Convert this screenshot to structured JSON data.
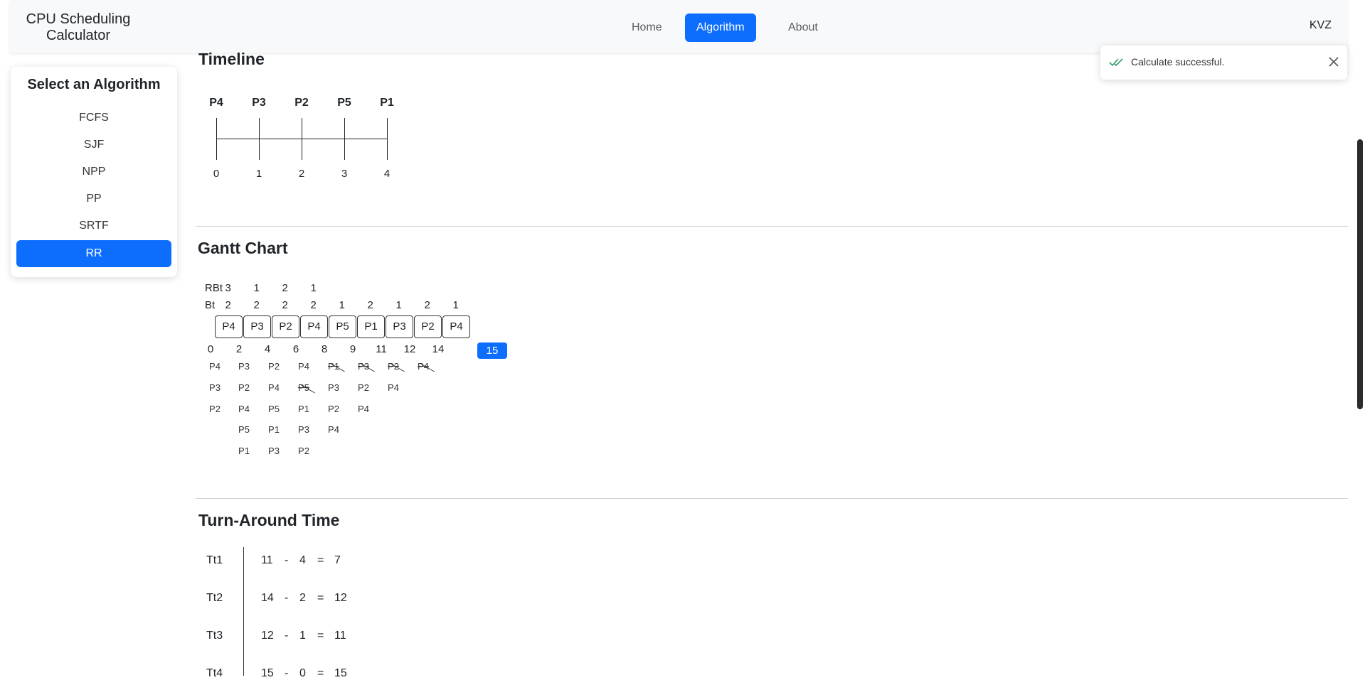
{
  "navbar": {
    "brand_line1": "CPU Scheduling",
    "brand_line2": "Calculator",
    "links": [
      "Home",
      "Algorithm",
      "About"
    ],
    "active": "Algorithm",
    "user": "KVZ"
  },
  "sidebar": {
    "title": "Select an Algorithm",
    "items": [
      "FCFS",
      "SJF",
      "NPP",
      "PP",
      "SRTF",
      "RR"
    ],
    "active": "RR"
  },
  "toast": {
    "message": "Calculate successful."
  },
  "timeline": {
    "title": "Timeline",
    "processes": [
      "P4",
      "P3",
      "P2",
      "P5",
      "P1"
    ],
    "times": [
      "0",
      "1",
      "2",
      "3",
      "4"
    ]
  },
  "gantt": {
    "title": "Gantt Chart",
    "rbt_label": "RBt",
    "rbt_values": [
      "3",
      "1",
      "2",
      "1"
    ],
    "bt_label": "Bt",
    "bt_values": [
      "2",
      "2",
      "2",
      "2",
      "1",
      "2",
      "1",
      "2",
      "1"
    ],
    "blocks": [
      "P4",
      "P3",
      "P2",
      "P4",
      "P5",
      "P1",
      "P3",
      "P2",
      "P4"
    ],
    "times": [
      "0",
      "2",
      "4",
      "6",
      "8",
      "9",
      "11",
      "12",
      "14"
    ],
    "end_time": "15",
    "queues": [
      [
        "P4",
        "P3",
        "P2"
      ],
      [
        "P3",
        "P2",
        "P4",
        "P5",
        "P1"
      ],
      [
        "P2",
        "P4",
        "P5",
        "P1",
        "P3"
      ],
      [
        "P4",
        "P5",
        "P1",
        "P3",
        "P2"
      ],
      [
        "P1",
        "P3",
        "P2",
        "P4"
      ],
      [
        "P3",
        "P2",
        "P4"
      ],
      [
        "P2",
        "P4"
      ],
      [
        "P4"
      ]
    ]
  },
  "tat": {
    "title": "Turn-Around Time",
    "rows": [
      {
        "label": "Tt1",
        "a": "11",
        "op": "-",
        "b": "4",
        "eq": "=",
        "r": "7"
      },
      {
        "label": "Tt2",
        "a": "14",
        "op": "-",
        "b": "2",
        "eq": "=",
        "r": "12"
      },
      {
        "label": "Tt3",
        "a": "12",
        "op": "-",
        "b": "1",
        "eq": "=",
        "r": "11"
      },
      {
        "label": "Tt4",
        "a": "15",
        "op": "-",
        "b": "0",
        "eq": "=",
        "r": "15"
      }
    ]
  }
}
